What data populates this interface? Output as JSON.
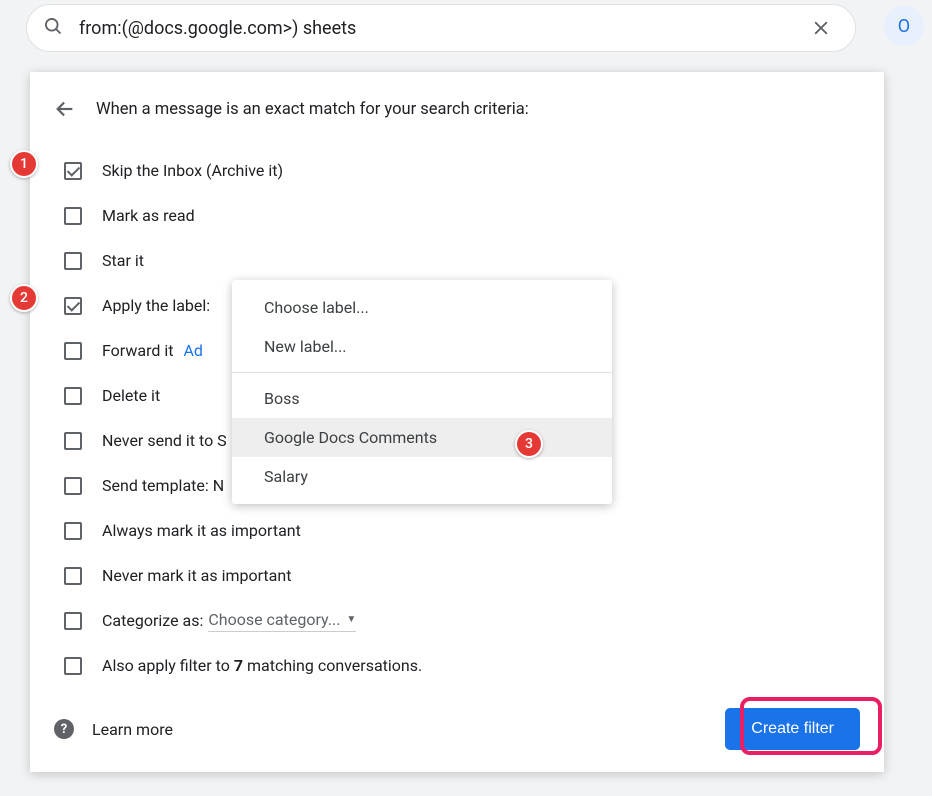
{
  "search": {
    "query": "from:(@docs.google.com>) sheets"
  },
  "avatar": {
    "initial": "O"
  },
  "panel": {
    "header": "When a message is an exact match for your search criteria:",
    "rows": {
      "skip_inbox": "Skip the Inbox (Archive it)",
      "mark_read": "Mark as read",
      "star_it": "Star it",
      "apply_label": "Apply the label:",
      "forward_it": "Forward it",
      "forward_add": "Ad",
      "delete_it": "Delete it",
      "never_spam": "Never send it to S",
      "send_template": "Send template:  N",
      "always_important": "Always mark it as important",
      "never_important": "Never mark it as important",
      "categorize_as": "Categorize as:",
      "categorize_placeholder": "Choose category...",
      "also_apply_prefix": "Also apply filter to ",
      "also_apply_count": "7",
      "also_apply_suffix": " matching conversations."
    },
    "footer": {
      "learn_more": "Learn more",
      "create_filter": "Create filter"
    }
  },
  "dropdown": {
    "choose_label": "Choose label...",
    "new_label": "New label...",
    "items": {
      "boss": "Boss",
      "google_docs_comments": "Google Docs Comments",
      "salary": "Salary"
    }
  },
  "annotations": {
    "a1": "1",
    "a2": "2",
    "a3": "3"
  }
}
